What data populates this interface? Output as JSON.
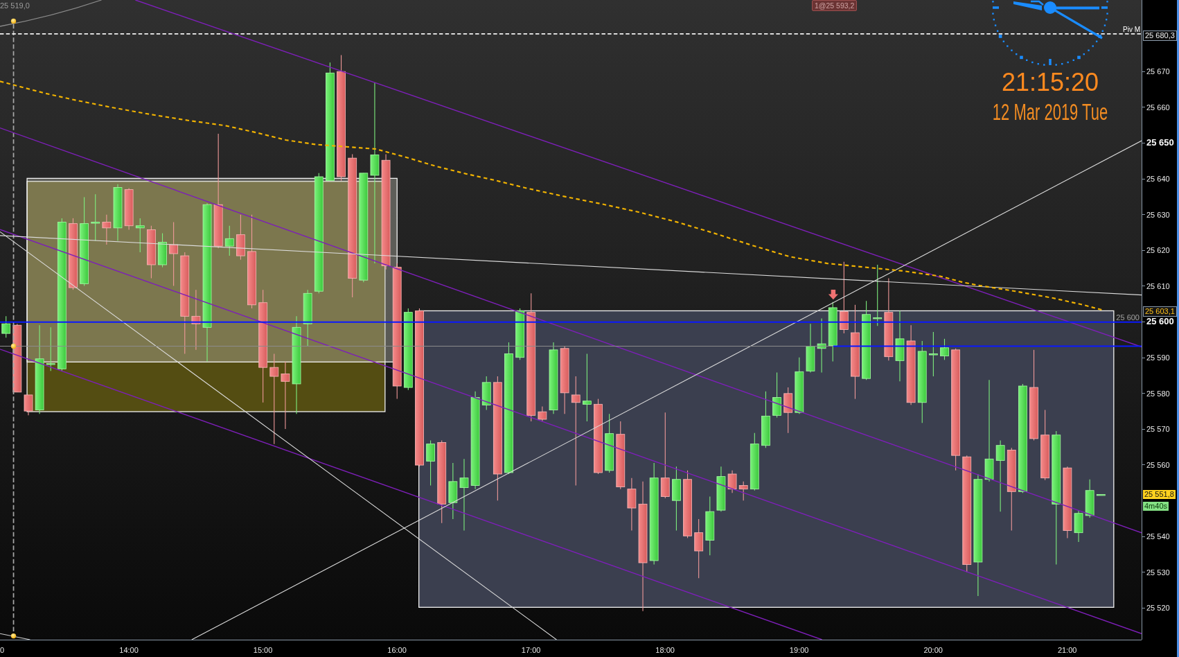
{
  "chart": {
    "corner_value": "25 519,0",
    "order_tag": "1@25 593,2",
    "pivot_label": "Piv M",
    "level_label": "25 600",
    "chart_data": {
      "type": "candlestick",
      "xlim": [
        782.3,
        1293.2
      ],
      "ylim": [
        25511.2,
        25690.0
      ],
      "x": [
        785,
        790,
        795,
        800,
        805,
        810,
        815,
        820,
        825,
        830,
        835,
        840,
        845,
        850,
        855,
        860,
        865,
        870,
        875,
        880,
        885,
        890,
        895,
        900,
        905,
        910,
        915,
        920,
        925,
        930,
        935,
        940,
        945,
        950,
        955,
        960,
        965,
        970,
        975,
        980,
        985,
        990,
        995,
        1000,
        1005,
        1010,
        1015,
        1020,
        1025,
        1030,
        1035,
        1040,
        1045,
        1050,
        1055,
        1060,
        1065,
        1070,
        1075,
        1080,
        1085,
        1090,
        1095,
        1100,
        1105,
        1110,
        1115,
        1120,
        1125,
        1130,
        1135,
        1140,
        1145,
        1150,
        1155,
        1160,
        1165,
        1170,
        1175,
        1180,
        1185,
        1190,
        1195,
        1200,
        1205,
        1210,
        1215,
        1220,
        1225,
        1230,
        1235,
        1240,
        1245,
        1250,
        1255,
        1260,
        1265,
        1270,
        1275
      ],
      "ohlc": [
        [
          25596.8,
          25601.6,
          25595.6,
          25599.5
        ],
        [
          25599.1,
          25599.5,
          25580.4,
          25580.4
        ],
        [
          25579.6,
          25579.6,
          25573.9,
          25575.1
        ],
        [
          25575.4,
          25599.1,
          25574.3,
          25589.7
        ],
        [
          25588.4,
          25598.5,
          25586.3,
          25588.4
        ],
        [
          25586.9,
          25629.0,
          25586.3,
          25627.9
        ],
        [
          25627.5,
          25629.0,
          25609.0,
          25609.6
        ],
        [
          25610.7,
          25634.9,
          25610.1,
          25627.5
        ],
        [
          25627.9,
          25635.7,
          25622.7,
          25627.9
        ],
        [
          25627.9,
          25630.0,
          25621.6,
          25626.3
        ],
        [
          25626.3,
          25638.5,
          25622.7,
          25637.6
        ],
        [
          25637.0,
          25637.4,
          25625.8,
          25626.9
        ],
        [
          25626.3,
          25629.0,
          25619.5,
          25626.9
        ],
        [
          25625.8,
          25626.9,
          25612.2,
          25616.0
        ],
        [
          25616.0,
          25624.8,
          25615.3,
          25622.3
        ],
        [
          25621.6,
          25627.9,
          25610.1,
          25619.1
        ],
        [
          25618.5,
          25619.5,
          25591.1,
          25601.6
        ],
        [
          25601.6,
          25609.0,
          25592.2,
          25599.5
        ],
        [
          25598.5,
          25633.2,
          25589.0,
          25632.8
        ],
        [
          25632.8,
          25652.6,
          25620.6,
          25621.2
        ],
        [
          25621.2,
          25626.9,
          25618.5,
          25623.3
        ],
        [
          25624.4,
          25630.0,
          25617.4,
          25618.5
        ],
        [
          25619.7,
          25630.0,
          25603.8,
          25604.8
        ],
        [
          25605.4,
          25609.0,
          25577.5,
          25587.3
        ],
        [
          25587.3,
          25591.1,
          25565.9,
          25584.8
        ],
        [
          25585.5,
          25589.0,
          25570.1,
          25583.4
        ],
        [
          25582.7,
          25601.6,
          25574.3,
          25598.5
        ],
        [
          25599.5,
          25609.0,
          25593.2,
          25608.0
        ],
        [
          25608.6,
          25641.6,
          25608.0,
          25640.6
        ],
        [
          25639.5,
          25672.5,
          25639.5,
          25669.6
        ],
        [
          25670.0,
          25674.6,
          25639.5,
          25640.6
        ],
        [
          25645.8,
          25646.9,
          25606.9,
          25612.2
        ],
        [
          25611.7,
          25641.6,
          25611.1,
          25641.6
        ],
        [
          25641.0,
          25666.9,
          25616.4,
          25646.7
        ],
        [
          25645.2,
          25646.9,
          25614.7,
          25615.7
        ],
        [
          25615.3,
          25616.4,
          25578.5,
          25582.1
        ],
        [
          25581.7,
          25603.8,
          25581.0,
          25602.7
        ],
        [
          25603.1,
          25603.8,
          25559.6,
          25560.0
        ],
        [
          25561.1,
          25566.9,
          25554.3,
          25565.9
        ],
        [
          25566.3,
          25566.9,
          25543.8,
          25549.1
        ],
        [
          25549.5,
          25560.6,
          25544.9,
          25555.4
        ],
        [
          25553.7,
          25561.7,
          25541.7,
          25556.4
        ],
        [
          25554.3,
          25580.6,
          25553.3,
          25578.9
        ],
        [
          25576.8,
          25584.8,
          25575.4,
          25583.1
        ],
        [
          25583.1,
          25584.8,
          25550.1,
          25557.5
        ],
        [
          25557.9,
          25594.3,
          25557.5,
          25591.1
        ],
        [
          25590.1,
          25603.8,
          25589.4,
          25603.1
        ],
        [
          25602.7,
          25608.0,
          25572.2,
          25573.9
        ],
        [
          25574.9,
          25576.4,
          25572.2,
          25572.8
        ],
        [
          25575.4,
          25594.3,
          25574.3,
          25592.2
        ],
        [
          25592.6,
          25593.2,
          25574.3,
          25580.2
        ],
        [
          25579.6,
          25584.8,
          25554.3,
          25577.5
        ],
        [
          25577.0,
          25591.1,
          25572.2,
          25577.9
        ],
        [
          25577.0,
          25578.5,
          25557.5,
          25557.9
        ],
        [
          25558.5,
          25574.3,
          25557.9,
          25568.8
        ],
        [
          25568.6,
          25572.2,
          25553.3,
          25553.9
        ],
        [
          25553.3,
          25556.4,
          25541.7,
          25548.0
        ],
        [
          25549.1,
          25555.4,
          25519.2,
          25532.7
        ],
        [
          25533.3,
          25560.6,
          25532.2,
          25556.4
        ],
        [
          25556.4,
          25574.7,
          25550.7,
          25551.2
        ],
        [
          25550.1,
          25559.6,
          25541.7,
          25556.0
        ],
        [
          25556.0,
          25558.5,
          25539.6,
          25540.2
        ],
        [
          25541.1,
          25544.9,
          25528.4,
          25536.0
        ],
        [
          25539.0,
          25551.2,
          25534.8,
          25547.0
        ],
        [
          25547.4,
          25559.6,
          25547.0,
          25556.8
        ],
        [
          25557.5,
          25558.5,
          25552.2,
          25553.3
        ],
        [
          25554.3,
          25555.4,
          25550.1,
          25553.3
        ],
        [
          25553.3,
          25569.0,
          25552.9,
          25565.9
        ],
        [
          25565.5,
          25580.6,
          25564.8,
          25573.7
        ],
        [
          25573.9,
          25585.9,
          25573.3,
          25578.9
        ],
        [
          25580.0,
          25581.7,
          25569.0,
          25574.7
        ],
        [
          25574.7,
          25590.1,
          25574.3,
          25586.1
        ],
        [
          25586.3,
          25599.5,
          25585.9,
          25593.2
        ],
        [
          25592.6,
          25601.0,
          25585.9,
          25593.9
        ],
        [
          25593.4,
          25605.6,
          25589.0,
          25604.0
        ],
        [
          25602.9,
          25616.8,
          25596.8,
          25597.9
        ],
        [
          25597.0,
          25604.8,
          25578.5,
          25584.8
        ],
        [
          25584.2,
          25605.9,
          25583.8,
          25602.1
        ],
        [
          25601.2,
          25616.0,
          25598.9,
          25601.2
        ],
        [
          25602.7,
          25612.2,
          25589.2,
          25590.3
        ],
        [
          25589.2,
          25603.1,
          25583.4,
          25595.3
        ],
        [
          25594.7,
          25599.1,
          25576.8,
          25577.5
        ],
        [
          25577.5,
          25594.7,
          25571.8,
          25591.8
        ],
        [
          25591.1,
          25597.2,
          25584.8,
          25591.1
        ],
        [
          25590.5,
          25595.3,
          25589.4,
          25592.8
        ],
        [
          25592.2,
          25592.6,
          25558.5,
          25562.7
        ],
        [
          25562.3,
          25562.7,
          25530.1,
          25532.2
        ],
        [
          25532.9,
          25557.5,
          25523.4,
          25556.0
        ],
        [
          25556.0,
          25583.8,
          25555.4,
          25561.7
        ],
        [
          25561.3,
          25566.9,
          25547.0,
          25565.5
        ],
        [
          25564.2,
          25564.8,
          25541.7,
          25552.6
        ],
        [
          25552.6,
          25582.7,
          25552.2,
          25582.1
        ],
        [
          25581.7,
          25592.2,
          25566.9,
          25567.4
        ],
        [
          25568.4,
          25575.4,
          25555.8,
          25556.4
        ],
        [
          25549.1,
          25569.5,
          25532.2,
          25568.4
        ],
        [
          25559.2,
          25559.6,
          25539.6,
          25541.7
        ],
        [
          25541.1,
          25547.4,
          25538.5,
          25546.5
        ],
        [
          25545.9,
          25556.0,
          25545.3,
          25552.9
        ],
        [
          25551.8,
          25551.8,
          25551.8,
          25551.8
        ]
      ],
      "xticks": [
        {
          "value": 840,
          "label": "14:00"
        },
        {
          "value": 900,
          "label": "15:00"
        },
        {
          "value": 960,
          "label": "16:00"
        },
        {
          "value": 1020,
          "label": "17:00"
        },
        {
          "value": 1080,
          "label": "18:00"
        },
        {
          "value": 1140,
          "label": "19:00"
        },
        {
          "value": 1200,
          "label": "20:00"
        },
        {
          "value": 1260,
          "label": "21:00"
        }
      ],
      "yticks": [
        {
          "value": 25670,
          "label": "25 670"
        },
        {
          "value": 25660,
          "label": "25 660"
        },
        {
          "value": 25650,
          "label": "25 650"
        },
        {
          "value": 25640,
          "label": "25 640"
        },
        {
          "value": 25630,
          "label": "25 630"
        },
        {
          "value": 25620,
          "label": "25 620"
        },
        {
          "value": 25610,
          "label": "25 610"
        },
        {
          "value": 25600,
          "label": "25 600"
        },
        {
          "value": 25590,
          "label": "25 590"
        },
        {
          "value": 25580,
          "label": "25 580"
        },
        {
          "value": 25570,
          "label": "25 570"
        },
        {
          "value": 25560,
          "label": "25 560"
        },
        {
          "value": 25540,
          "label": "25 540"
        },
        {
          "value": 25530,
          "label": "25 530"
        },
        {
          "value": 25520,
          "label": "25 520"
        }
      ]
    }
  },
  "clock": {
    "time": "21:15:20",
    "date": "12 Mar 2019 Tue"
  },
  "price_axis": {
    "markers": [
      {
        "kind": "pivot",
        "label": "25 680,3"
      },
      {
        "kind": "average",
        "label": "25 603,1"
      },
      {
        "kind": "last",
        "label": "25 551,8"
      },
      {
        "kind": "countdown",
        "label": "4m40s"
      }
    ]
  },
  "time_axis": {
    "edge_label": "0"
  }
}
